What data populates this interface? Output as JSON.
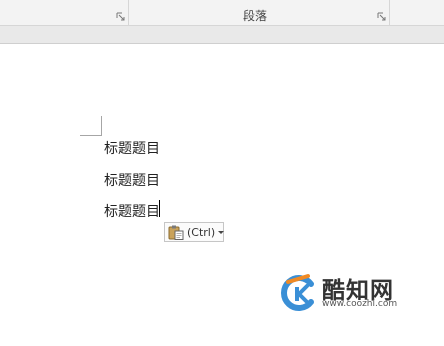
{
  "ribbon": {
    "group_label": "段落"
  },
  "document": {
    "lines": [
      "标题题目",
      "标题题目",
      "标题题目"
    ]
  },
  "paste_options": {
    "label": "(Ctrl)"
  },
  "watermark": {
    "name": "酷知网",
    "url": "www.coozhi.com"
  }
}
